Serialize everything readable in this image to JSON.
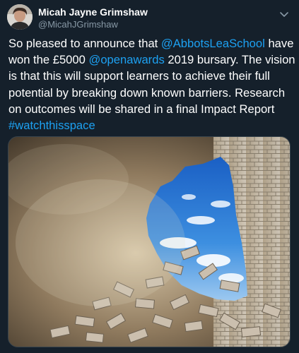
{
  "author": {
    "display_name": "Micah Jayne Grimshaw",
    "handle": "@MicahJGrimshaw"
  },
  "tweet": {
    "line1": {
      "pre": "So pleased to announce that ",
      "mention": "@AbbotsLeaSchool",
      "post": " have"
    },
    "line2": {
      "pre": "won the £5000 ",
      "mention": "@openawards",
      "post": " 2019 bursary. The vision"
    },
    "line3": "is that this will support learners to achieve their full",
    "line4": "potential by breaking down known barriers. Research",
    "line5": "on outcomes will be shared in a final Impact Report",
    "hashtag": "#watchthisspace"
  },
  "icons": {
    "avatar": "profile-photo",
    "menu": "chevron-down-icon",
    "media": "brick-wall-breaking-open-to-sky-image"
  },
  "colors": {
    "background": "#15202b",
    "text": "#ffffff",
    "secondary_text": "#8899a6",
    "link": "#1da1f2",
    "sky": "#2f7fd6"
  }
}
